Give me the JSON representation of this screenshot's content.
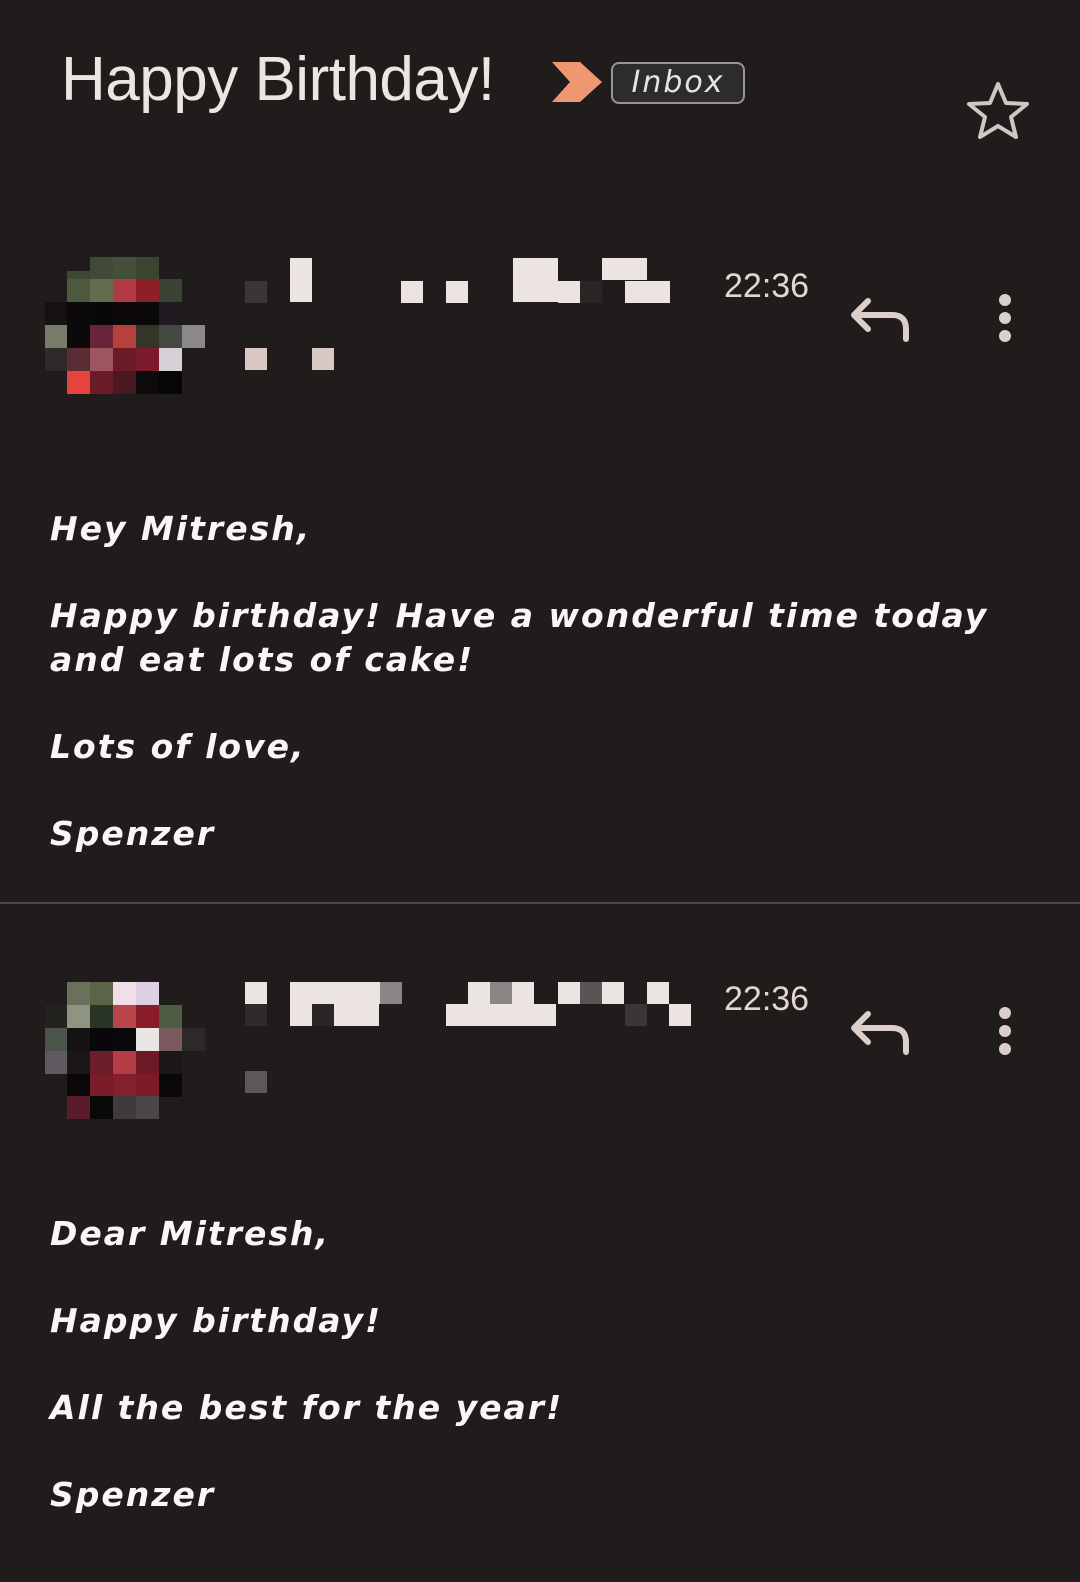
{
  "thread": {
    "subject": "Happy Birthday!",
    "label": "Inbox",
    "important_icon": "important-arrow-icon",
    "star_icon": "star-outline-icon"
  },
  "colors": {
    "background": "#201c1b",
    "important": "#ee9872",
    "text": "#faf6f5",
    "divider": "#4a4544"
  },
  "messages": [
    {
      "time": "22:36",
      "reply_icon": "reply-icon",
      "more_icon": "more-vert-icon",
      "body": [
        "Hey Mitresh,",
        "Happy birthday! Have a wonderful time today and eat lots of cake!",
        "Lots of love,",
        "Spenzer"
      ]
    },
    {
      "time": "22:36",
      "reply_icon": "reply-icon",
      "more_icon": "more-vert-icon",
      "body": [
        "Dear Mitresh,",
        "Happy birthday!",
        "All the best for the year!",
        "Spenzer"
      ]
    }
  ]
}
